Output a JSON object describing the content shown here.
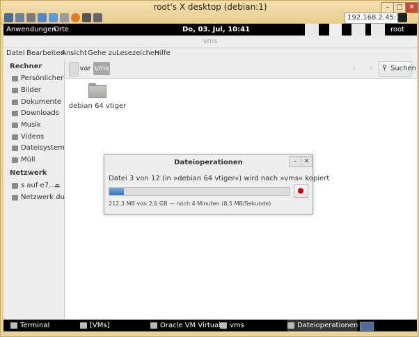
{
  "vnc": {
    "title": "root's X desktop (debian:1)",
    "host": "192.168.2.45:1",
    "toolbar_icons": [
      "connection-options-icon",
      "connection-info-icon",
      "refresh-icon",
      "send-ctrl-alt-del-icon",
      "windows-key-icon",
      "keyboard-icon",
      "help-icon",
      "new-connection-icon",
      "save-icon",
      "fullscreen-icon"
    ],
    "window_buttons": [
      "–",
      "□",
      "✕"
    ]
  },
  "top_panel": {
    "applications": "Anwendungen",
    "places": "Orte",
    "clock": "Do, 03. Jul, 10:41",
    "user": "root"
  },
  "nautilus": {
    "title": "vms",
    "menu": [
      "Datei",
      "Bearbeiten",
      "Ansicht",
      "Gehe zu",
      "Lesezeichen",
      "Hilfe"
    ],
    "breadcrumbs": [
      "var",
      "vms"
    ],
    "search_label": "Suchen",
    "sidebar": {
      "section_computer": "Rechner",
      "computer_items": [
        "Persönlicher ...",
        "Bilder",
        "Dokumente",
        "Downloads",
        "Musik",
        "Videos",
        "Dateisystem",
        "Müll"
      ],
      "section_network": "Netzwerk",
      "network_items": [
        "s auf e7...",
        "Netzwerk du..."
      ]
    },
    "folder_name": "debian 64 vtiger"
  },
  "dialog": {
    "title": "Dateioperationen",
    "message": "Datei 3 von 12 (in »debian 64 vtiger«) wird nach »vms« kopiert",
    "progress_fraction": 0.08,
    "status": "212,3 MB von 2,6 GB — noch 4 Minuten (8,5 MB/Sekunde)",
    "buttons": [
      "–",
      "✕"
    ]
  },
  "taskbar": [
    "Terminal",
    "[VMs]",
    "Oracle VM Virtual...",
    "vms",
    "Dateioperationen"
  ],
  "colors": {
    "accent": "#3a75c0",
    "stop": "#d00000",
    "vnc_frame": "#e9d4a0"
  }
}
